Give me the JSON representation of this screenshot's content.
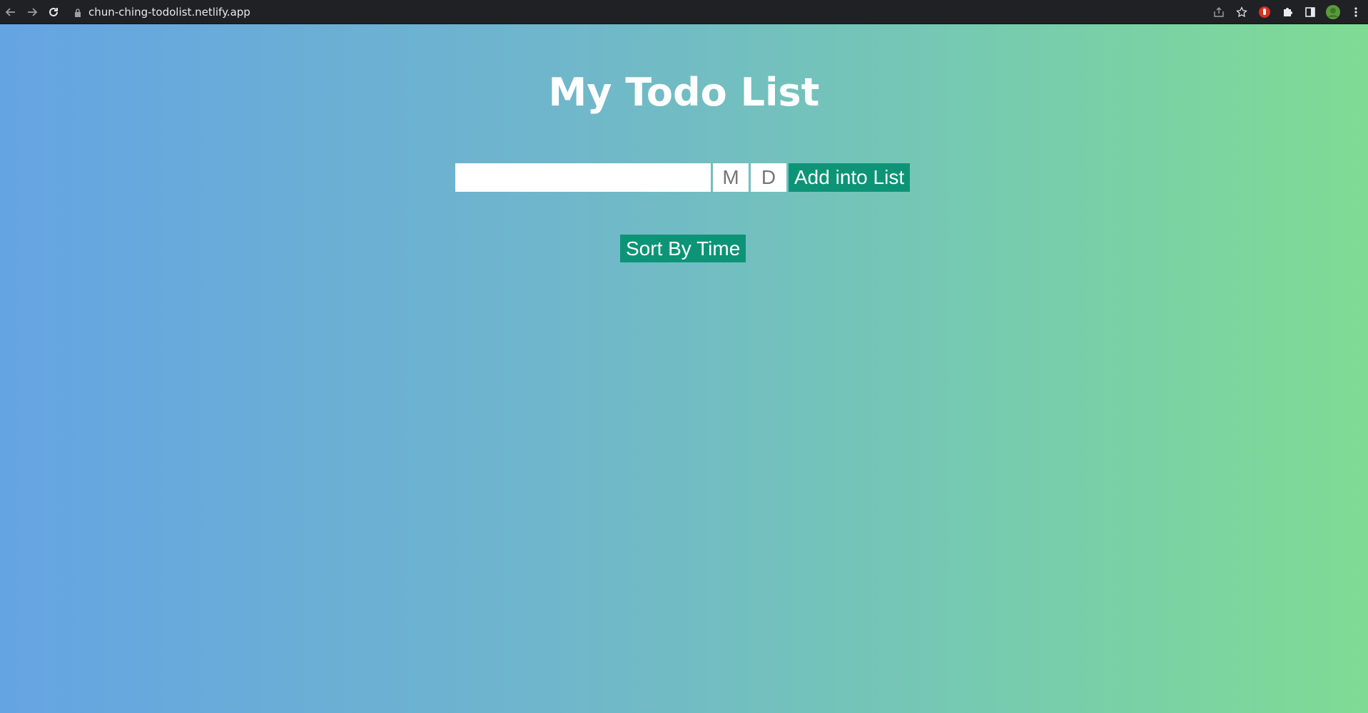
{
  "browser": {
    "url": "chun-ching-todolist.netlify.app",
    "icons": [
      "back-arrow-icon",
      "forward-arrow-icon",
      "reload-icon",
      "lock-icon",
      "share-icon",
      "star-icon",
      "extension-red-icon",
      "puzzle-icon",
      "side-panel-icon",
      "profile-avatar-icon",
      "kebab-menu-icon"
    ]
  },
  "page": {
    "title": "My Todo List",
    "gradient_start": "#65a4e3",
    "gradient_end": "#7fdb94"
  },
  "form": {
    "todo_value": "",
    "todo_placeholder": "",
    "month_placeholder": "M",
    "day_placeholder": "D",
    "add_label": "Add into List",
    "button_color": "#0d9477"
  },
  "sort": {
    "label": "Sort By Time"
  }
}
